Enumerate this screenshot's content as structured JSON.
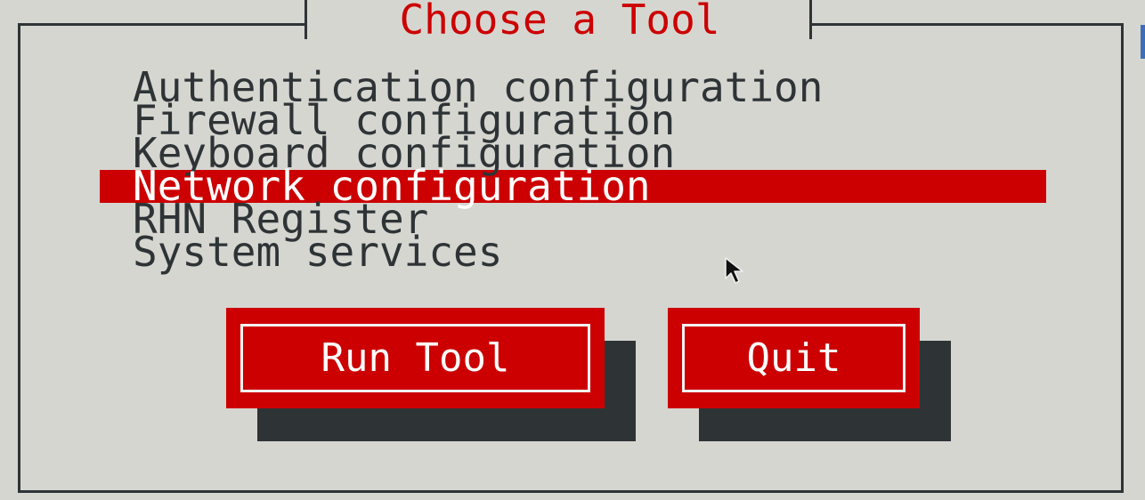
{
  "dialog": {
    "title": "Choose a Tool",
    "items": [
      {
        "label": "Authentication configuration",
        "selected": false
      },
      {
        "label": "Firewall configuration",
        "selected": false
      },
      {
        "label": "Keyboard configuration",
        "selected": false
      },
      {
        "label": "Network configuration",
        "selected": true
      },
      {
        "label": "RHN Register",
        "selected": false
      },
      {
        "label": "System services",
        "selected": false
      }
    ],
    "buttons": {
      "run_tool": "Run Tool",
      "quit": "Quit"
    }
  },
  "colors": {
    "background": "#d6d6d1",
    "accent": "#cc0000",
    "text": "#2e3436",
    "shadow": "#2e3436"
  },
  "icons": {
    "pointer": "mouse-pointer-icon"
  }
}
